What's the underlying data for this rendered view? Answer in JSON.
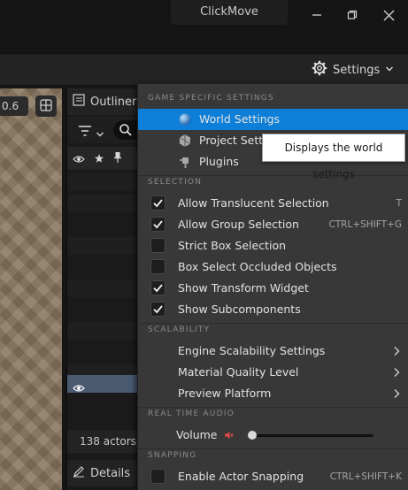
{
  "window": {
    "title": "ClickMove",
    "minimize_icon": "minimize-icon",
    "restore_icon": "restore-icon",
    "close_icon": "close-icon"
  },
  "toolbar": {
    "settings_label": "Settings",
    "settings_icon": "gear-icon"
  },
  "viewport": {
    "zoom_value": "0.6"
  },
  "outliner": {
    "tab_label": "Outliner",
    "actor_count": "138 actors",
    "details_label": "Details"
  },
  "menu": {
    "sections": {
      "game": "GAME SPECIFIC SETTINGS",
      "selection": "SELECTION",
      "scalability": "SCALABILITY",
      "audio": "REAL TIME AUDIO",
      "snapping": "SNAPPING"
    },
    "game_items": [
      {
        "label": "World Settings",
        "icon": "globe-icon",
        "highlighted": true
      },
      {
        "label": "Project Setti",
        "icon": "project-gears-icon"
      },
      {
        "label": "Plugins",
        "icon": "plug-icon"
      }
    ],
    "selection_items": [
      {
        "label": "Allow Translucent Selection",
        "checked": true,
        "shortcut": "T"
      },
      {
        "label": "Allow Group Selection",
        "checked": true,
        "shortcut": "CTRL+SHIFT+G"
      },
      {
        "label": "Strict Box Selection",
        "checked": false,
        "shortcut": ""
      },
      {
        "label": "Box Select Occluded Objects",
        "checked": false,
        "shortcut": ""
      },
      {
        "label": "Show Transform Widget",
        "checked": true,
        "shortcut": ""
      },
      {
        "label": "Show Subcomponents",
        "checked": true,
        "shortcut": ""
      }
    ],
    "scalability_items": [
      {
        "label": "Engine Scalability Settings"
      },
      {
        "label": "Material Quality Level"
      },
      {
        "label": "Preview Platform"
      }
    ],
    "volume_label": "Volume",
    "volume_level": 0.0,
    "snapping_items": [
      {
        "label": "Enable Actor Snapping",
        "checked": false,
        "shortcut": "CTRL+SHIFT+K"
      }
    ]
  },
  "tooltip": {
    "text": "Displays the world settings"
  },
  "colors": {
    "highlight": "#0e7fd8",
    "menu_bg": "#383838",
    "muted_icon": "#e04848"
  }
}
